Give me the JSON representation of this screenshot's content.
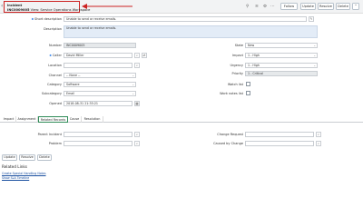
{
  "header": {
    "title_small": "Incident",
    "number": "INC0009005",
    "view_text": "View: Service Operations Workspace",
    "buttons": {
      "follow": "Follow",
      "update": "Update",
      "resolve": "Resolve",
      "delete": "Delete"
    },
    "accent_color": "#cc2222"
  },
  "form": {
    "short_description": {
      "label": "Short description",
      "value": "Unable to send or receive emails."
    },
    "description": {
      "label": "Description",
      "value": "Unable to send or receive emails."
    },
    "number": {
      "label": "Number",
      "value": "INC0009005"
    },
    "caller": {
      "label": "Caller",
      "value": "David Miller"
    },
    "location": {
      "label": "Location",
      "value": ""
    },
    "channel": {
      "label": "Channel",
      "value": "-- None --"
    },
    "category": {
      "label": "Category",
      "value": "Software"
    },
    "subcategory": {
      "label": "Subcategory",
      "value": "Email"
    },
    "opened": {
      "label": "Opened",
      "value": "2018-08-31 21:35:21"
    },
    "state": {
      "label": "State",
      "value": "New"
    },
    "impact": {
      "label": "Impact",
      "value": "1 - High"
    },
    "urgency": {
      "label": "Urgency",
      "value": "1 - High"
    },
    "priority": {
      "label": "Priority",
      "value": "1 - Critical"
    },
    "watch_list": {
      "label": "Watch list"
    },
    "work_notes_list": {
      "label": "Work notes list"
    }
  },
  "tabs": [
    "Impact",
    "Assignment",
    "Related Records",
    "Cause",
    "Resolution"
  ],
  "active_tab": "Related Records",
  "related_records": {
    "parent_incident": {
      "label": "Parent Incident",
      "value": ""
    },
    "problem": {
      "label": "Problem",
      "value": ""
    },
    "change_request": {
      "label": "Change Request",
      "value": ""
    },
    "caused_by_change": {
      "label": "Caused by Change",
      "value": ""
    }
  },
  "bottom_buttons": {
    "update": "Update",
    "resolve": "Resolve",
    "delete": "Delete"
  },
  "related_links": {
    "title": "Related Links",
    "items": [
      "Create Special Handling Notes",
      "Show SLA Timeline"
    ]
  }
}
